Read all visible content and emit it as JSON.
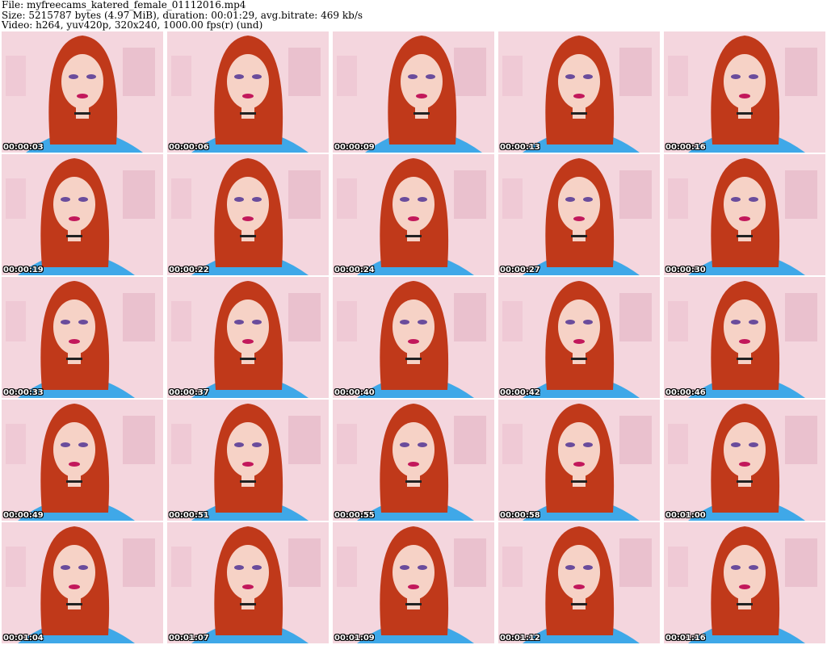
{
  "header": {
    "file_line": "File: myfreecams_katered_female_01112016.mp4",
    "size_line": "Size: 5215787 bytes (4.97 MiB), duration: 00:01:29, avg.bitrate: 469 kb/s",
    "video_line": "Video: h264, yuv420p, 320x240, 1000.00 fps(r) (und)"
  },
  "colors": {
    "background": "#ffffff",
    "wall": "#f4d6de",
    "hair": "#c0391a",
    "skin": "#f6d2c6",
    "shirt": "#3fa8e8",
    "lips": "#c2185b",
    "eyeshadow": "#6a4c9c",
    "timestamp_text": "#ffffff",
    "timestamp_outline": "#000000"
  },
  "frames": [
    {
      "timestamp": "00:00:03"
    },
    {
      "timestamp": "00:00:06"
    },
    {
      "timestamp": "00:00:09"
    },
    {
      "timestamp": "00:00:13"
    },
    {
      "timestamp": "00:00:16"
    },
    {
      "timestamp": "00:00:19"
    },
    {
      "timestamp": "00:00:22"
    },
    {
      "timestamp": "00:00:24"
    },
    {
      "timestamp": "00:00:27"
    },
    {
      "timestamp": "00:00:30"
    },
    {
      "timestamp": "00:00:33"
    },
    {
      "timestamp": "00:00:37"
    },
    {
      "timestamp": "00:00:40"
    },
    {
      "timestamp": "00:00:42"
    },
    {
      "timestamp": "00:00:46"
    },
    {
      "timestamp": "00:00:49"
    },
    {
      "timestamp": "00:00:51"
    },
    {
      "timestamp": "00:00:55"
    },
    {
      "timestamp": "00:00:58"
    },
    {
      "timestamp": "00:01:00"
    },
    {
      "timestamp": "00:01:04"
    },
    {
      "timestamp": "00:01:07"
    },
    {
      "timestamp": "00:01:09"
    },
    {
      "timestamp": "00:01:12"
    },
    {
      "timestamp": "00:01:16"
    }
  ]
}
